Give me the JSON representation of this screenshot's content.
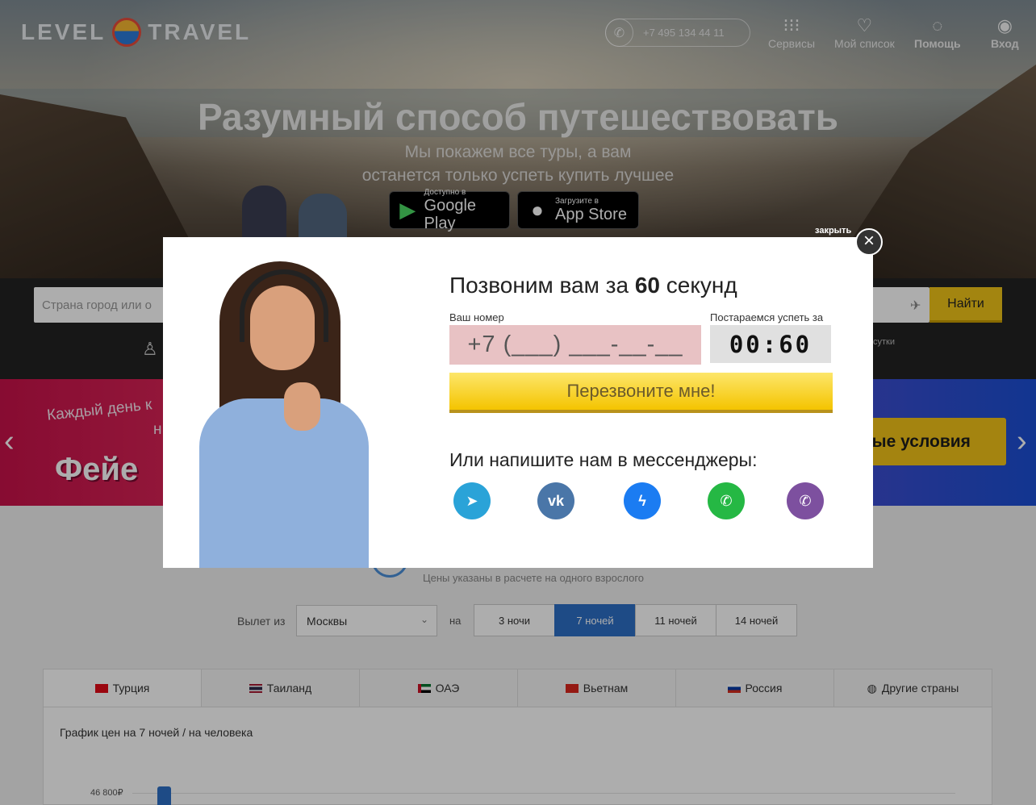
{
  "header": {
    "logo_left": "LEVEL",
    "logo_right": "TRAVEL",
    "phone": "+7 495 134 44 11",
    "nav": [
      {
        "label": "Сервисы",
        "icon": "grid-icon"
      },
      {
        "label": "Мой список",
        "icon": "heart-icon"
      },
      {
        "label": "Помощь",
        "icon": "lightbulb-icon"
      },
      {
        "label": "Вход",
        "icon": "user-icon"
      }
    ]
  },
  "hero": {
    "title": "Разумный способ путешествовать",
    "subtitle_line1": "Мы покажем все туры, а вам",
    "subtitle_line2": "останется только успеть купить лучшее",
    "google_play": {
      "small": "Доступно в",
      "big": "Google Play"
    },
    "app_store": {
      "small": "Загрузите в",
      "big": "App Store"
    }
  },
  "search": {
    "placeholder": "Страна город или о",
    "button": "Найти",
    "hint": "сутки"
  },
  "banner": {
    "line1": "Каждый день к",
    "line2": "н",
    "big": "Фейе",
    "cta": "ные условия"
  },
  "tours": {
    "subtitle": "Цены указаны в расчете на одного взрослого",
    "fly_label": "Вылет из",
    "city": "Москвы",
    "na_label": "на",
    "nights": [
      "3 ночи",
      "7 ночей",
      "11 ночей",
      "14 ночей"
    ],
    "active_night": 1,
    "countries": [
      "Турция",
      "Таиланд",
      "ОАЭ",
      "Вьетнам",
      "Россия",
      "Другие страны"
    ],
    "chart_title": "График цен на 7 ночей / на человека",
    "chart_tick": "46 800₽"
  },
  "modal": {
    "close_label": "закрыть",
    "title_pre": "Позвоним вам за ",
    "title_num": "60",
    "title_post": " секунд",
    "phone_label": "Ваш номер",
    "phone_mask": "+7 (___) ___-__-__",
    "timer_label": "Постараемся успеть за",
    "timer": "00:60",
    "callback_button": "Перезвоните мне!",
    "messengers_title": "Или напишите нам в мессенджеры:",
    "messengers": [
      "telegram",
      "vk",
      "messenger",
      "whatsapp",
      "viber"
    ]
  },
  "colors": {
    "accent_blue": "#2d6fc6",
    "yellow": "#f4c400",
    "phone_field": "#e8c2c4"
  }
}
